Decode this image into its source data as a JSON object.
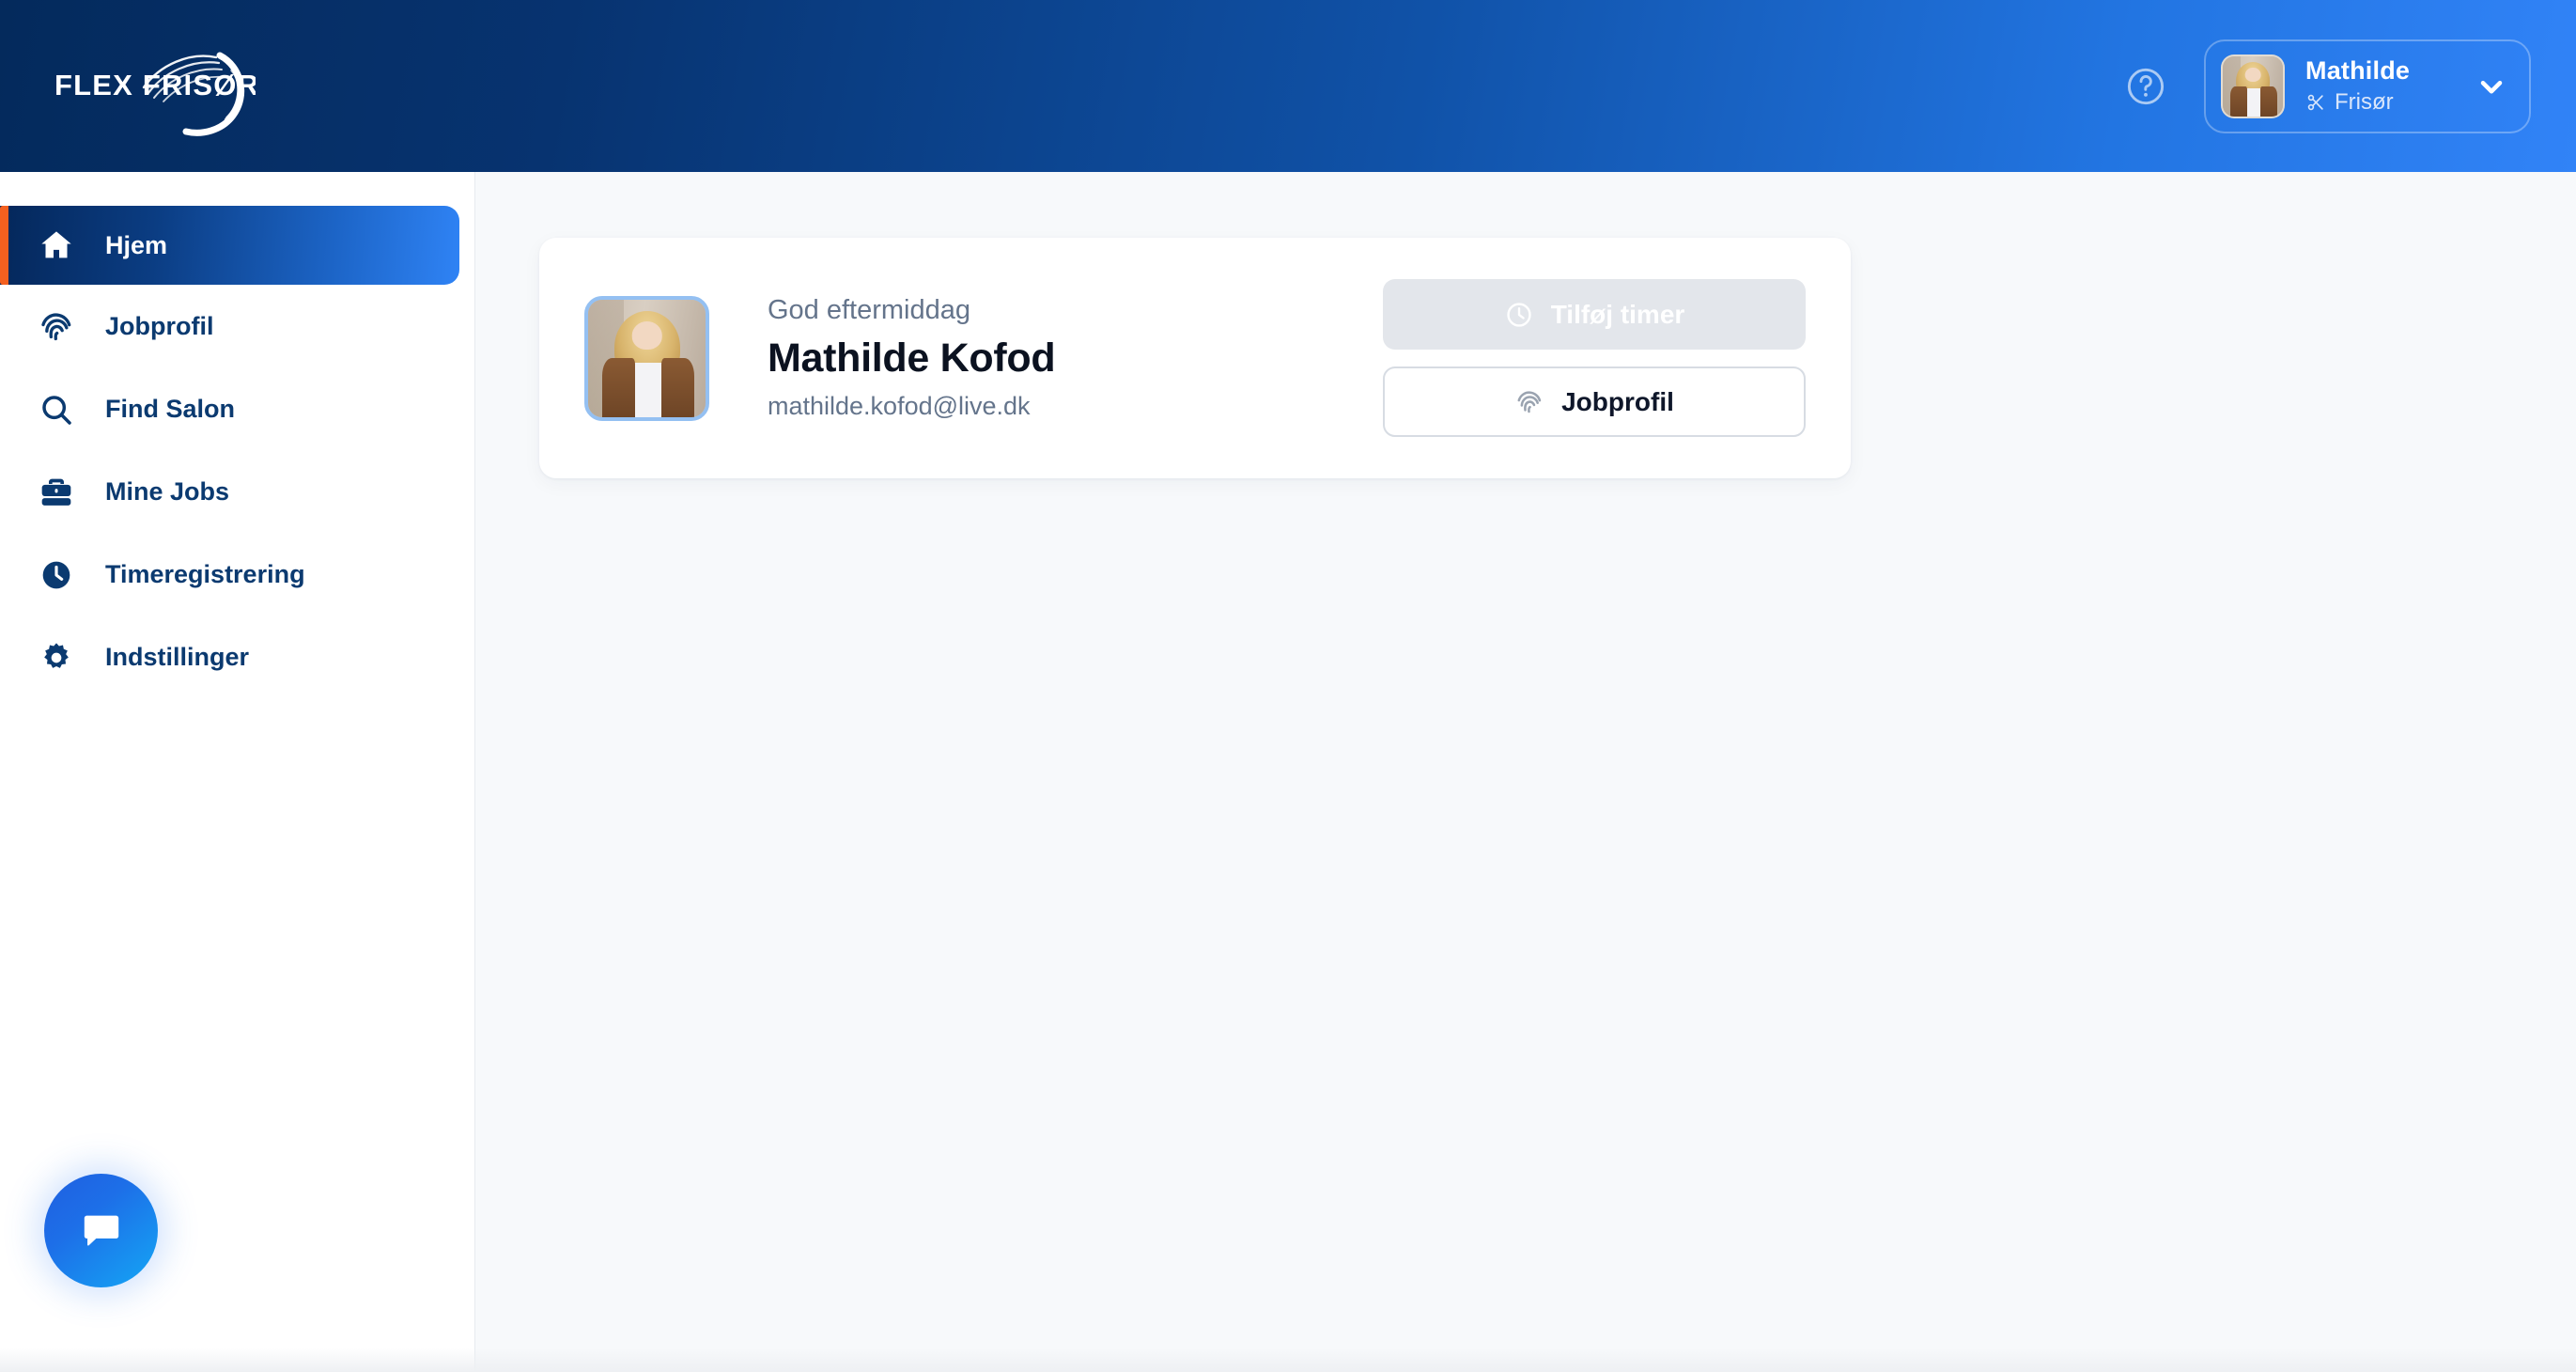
{
  "brand": {
    "logo_text": "FLEX FRISØR",
    "logo_icon": "hair-swoosh-icon",
    "header_gradient_from": "#042a5c",
    "header_gradient_to": "#3183f7"
  },
  "header": {
    "help_icon": "question-circle-icon",
    "user": {
      "name": "Mathilde",
      "role": "Frisør",
      "role_icon": "scissors-icon",
      "avatar_alt": "Mathilde",
      "chevron_icon": "chevron-down-icon"
    }
  },
  "sidebar": {
    "active_accent": "#f4601f",
    "items": [
      {
        "label": "Hjem",
        "icon": "home-icon",
        "active": true
      },
      {
        "label": "Jobprofil",
        "icon": "fingerprint-icon",
        "active": false
      },
      {
        "label": "Find Salon",
        "icon": "search-icon",
        "active": false
      },
      {
        "label": "Mine Jobs",
        "icon": "briefcase-icon",
        "active": false
      },
      {
        "label": "Timeregistrering",
        "icon": "clock-icon",
        "active": false
      },
      {
        "label": "Indstillinger",
        "icon": "gear-icon",
        "active": false
      }
    ],
    "chat_icon": "chat-bubble-icon"
  },
  "main": {
    "profile_card": {
      "greeting": "God eftermiddag",
      "full_name": "Mathilde Kofod",
      "email": "mathilde.kofod@live.dk",
      "avatar_alt": "Mathilde Kofod",
      "actions": [
        {
          "label": "Tilføj timer",
          "icon": "clock-icon",
          "state": "disabled"
        },
        {
          "label": "Jobprofil",
          "icon": "fingerprint-icon",
          "state": "enabled"
        }
      ]
    }
  }
}
